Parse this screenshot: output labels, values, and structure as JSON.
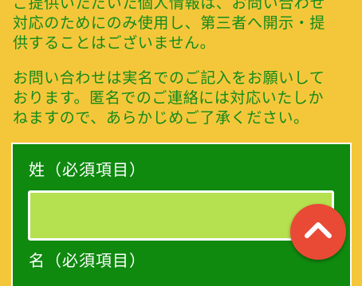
{
  "notice": {
    "line1": "ご提供いただいた個人情報は、お問い合わせ",
    "line2": "対応のためにのみ使用し、第三者へ開示・提",
    "line3": "供することはございません。",
    "line4": "お問い合わせは実名でのご記入をお願いして",
    "line5": "おります。匿名でのご連絡には対応いたしか",
    "line6": "ねますので、あらかじめご了承ください。"
  },
  "form": {
    "last_name_label": "姓（必須項目）",
    "last_name_value": "",
    "first_name_label": "名（必須項目）"
  },
  "scroll_top": {
    "icon": "chevron-up-icon"
  },
  "colors": {
    "background": "#f4c73a",
    "notice_text": "#128a1c",
    "form_panel": "#0f8a0f",
    "input_fill": "#b5e04f",
    "scroll_button": "#e94a35"
  }
}
